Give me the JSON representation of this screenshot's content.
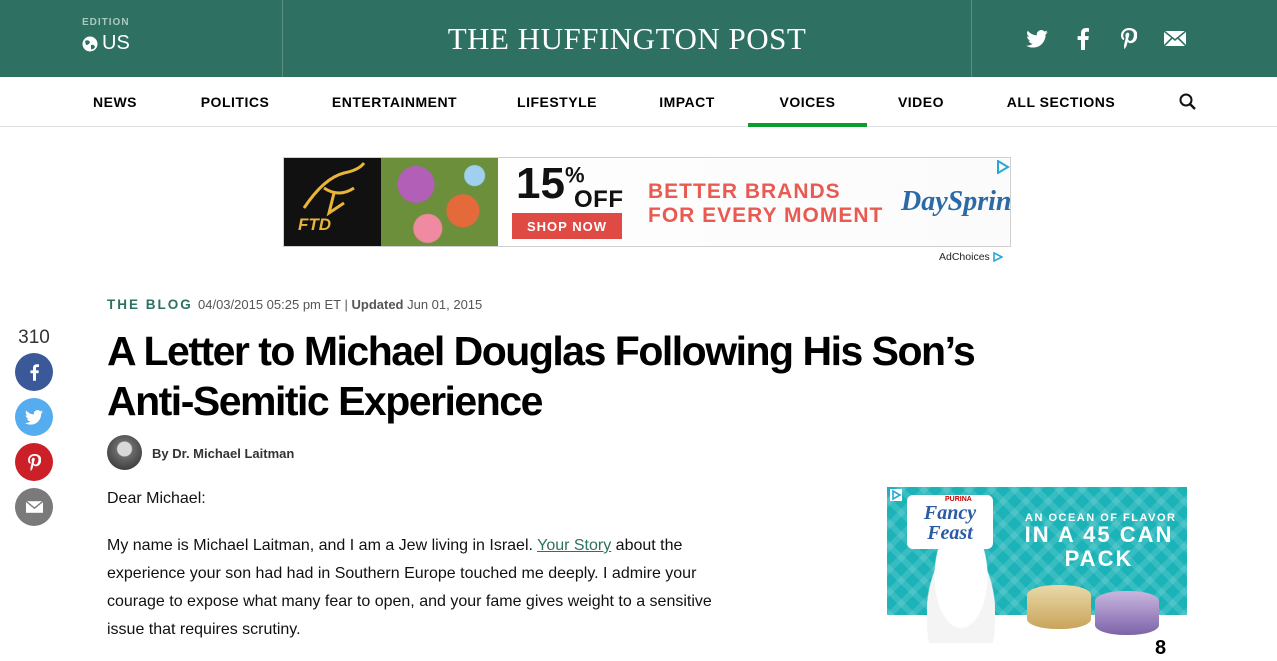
{
  "header": {
    "edition_label": "EDITION",
    "edition_value": "US",
    "logo": "THE HUFFINGTON POST",
    "social": [
      "twitter-icon",
      "facebook-icon",
      "pinterest-icon",
      "email-icon"
    ]
  },
  "nav": {
    "items": [
      {
        "label": "NEWS"
      },
      {
        "label": "POLITICS"
      },
      {
        "label": "ENTERTAINMENT"
      },
      {
        "label": "LIFESTYLE"
      },
      {
        "label": "IMPACT"
      },
      {
        "label": "VOICES",
        "active": true
      },
      {
        "label": "VIDEO"
      },
      {
        "label": "ALL SECTIONS"
      }
    ],
    "active_color": "#0c9d2f"
  },
  "banner_ad": {
    "ftd": "FTD",
    "percent": "15",
    "percent_sign": "%",
    "off": "OFF",
    "cta": "SHOP NOW",
    "line1": "BETTER BRANDS",
    "line2": "FOR EVERY MOMENT",
    "brand": "DaySpring",
    "adchoices": "AdChoices"
  },
  "share": {
    "count": "310",
    "buttons": [
      {
        "icon": "facebook-icon",
        "color": "#3b5998"
      },
      {
        "icon": "twitter-icon",
        "color": "#55acee"
      },
      {
        "icon": "pinterest-icon",
        "color": "#cb2027"
      },
      {
        "icon": "email-icon",
        "color": "#7a7a7a"
      }
    ]
  },
  "article": {
    "section": "THE BLOG",
    "date": "04/03/2015 05:25 pm ET",
    "separator": " | ",
    "updated_label": "Updated",
    "updated_date": " Jun 01, 2015",
    "title_line1": "A Letter to Michael Douglas Following His Son’s",
    "title_line2": "Anti-Semitic Experience",
    "byline": "By Dr. Michael Laitman",
    "salutation": "Dear Michael:",
    "p1_before": "My name is Michael Laitman, and I am a Jew living in Israel. ",
    "p1_link": "Your Story",
    "p1_line1_after": " about the",
    "p1_line2": "experience your son had had in Southern Europe touched me deeply. I admire your",
    "p1_line3": "courage to expose what many fear to open, and your fame gives weight to a sensitive",
    "p1_line4": "issue that requires scrutiny."
  },
  "side_ad": {
    "purina": "PURINA",
    "brand_line1": "Fancy",
    "brand_line2": "Feast",
    "tagline": "AN OCEAN OF FLAVOR",
    "headline": "IN A 45 CAN PACK",
    "partial": "8"
  },
  "colors": {
    "brand_green": "#2e7061",
    "link": "#2e7061"
  }
}
